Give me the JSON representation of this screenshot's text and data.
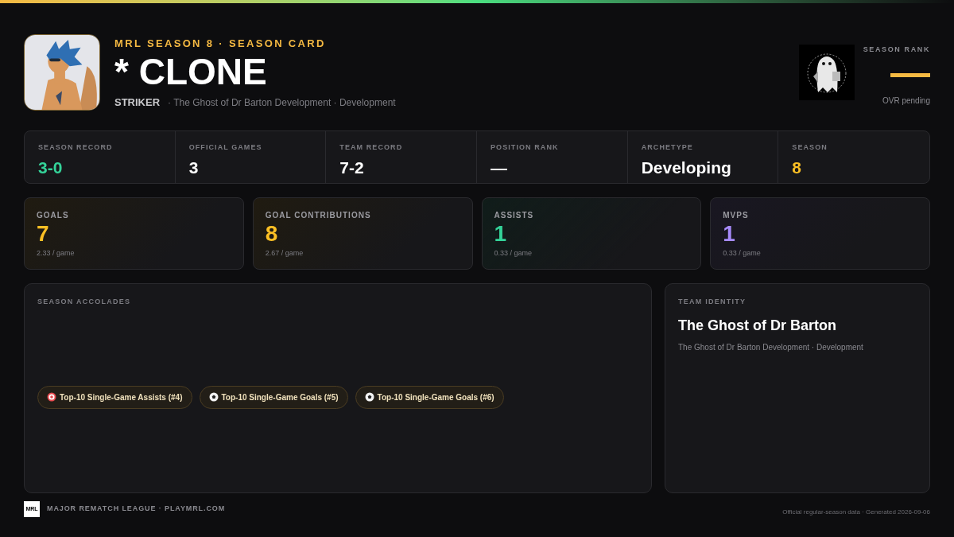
{
  "header": {
    "eyebrow": "MRL SEASON 8 · SEASON CARD",
    "player_name": "* CLONE",
    "position": "STRIKER",
    "team_line": "· The Ghost of Dr Barton Development · Development"
  },
  "rank": {
    "label": "SEASON RANK",
    "note": "OVR pending"
  },
  "summary": [
    {
      "label": "SEASON RECORD",
      "value": "3-0",
      "color": "#34d399"
    },
    {
      "label": "OFFICIAL GAMES",
      "value": "3",
      "color": "#ffffff"
    },
    {
      "label": "TEAM RECORD",
      "value": "7-2",
      "color": "#ffffff"
    },
    {
      "label": "POSITION RANK",
      "value": "—",
      "color": "#ffffff"
    },
    {
      "label": "ARCHETYPE",
      "value": "Developing",
      "color": "#ffffff"
    },
    {
      "label": "SEASON",
      "value": "8",
      "color": "#fbbf24"
    }
  ],
  "stat_cards": [
    {
      "label": "GOALS",
      "value": "7",
      "per_game": "2.33 / game",
      "color": "#fbbf24"
    },
    {
      "label": "GOAL CONTRIBUTIONS",
      "value": "8",
      "per_game": "2.67 / game",
      "color": "#fbbf24"
    },
    {
      "label": "ASSISTS",
      "value": "1",
      "per_game": "0.33 / game",
      "color": "#34d399"
    },
    {
      "label": "MVPS",
      "value": "1",
      "per_game": "0.33 / game",
      "color": "#a78bfa"
    }
  ],
  "accolades": {
    "title": "SEASON ACCOLADES",
    "items": [
      {
        "kind": "target",
        "label": "Top-10 Single-Game Assists (#4)"
      },
      {
        "kind": "ball",
        "label": "Top-10 Single-Game Goals (#5)"
      },
      {
        "kind": "ball",
        "label": "Top-10 Single-Game Goals (#6)"
      }
    ]
  },
  "team_identity": {
    "title": "TEAM IDENTITY",
    "team": "The Ghost of Dr Barton",
    "subtitle": "The Ghost of Dr Barton Development · Development"
  },
  "footer": {
    "logo": "MRL",
    "league": "MAJOR REMATCH LEAGUE · PLAYMRL.COM",
    "note": "Official regular-season data · Generated 2026-09-06"
  }
}
